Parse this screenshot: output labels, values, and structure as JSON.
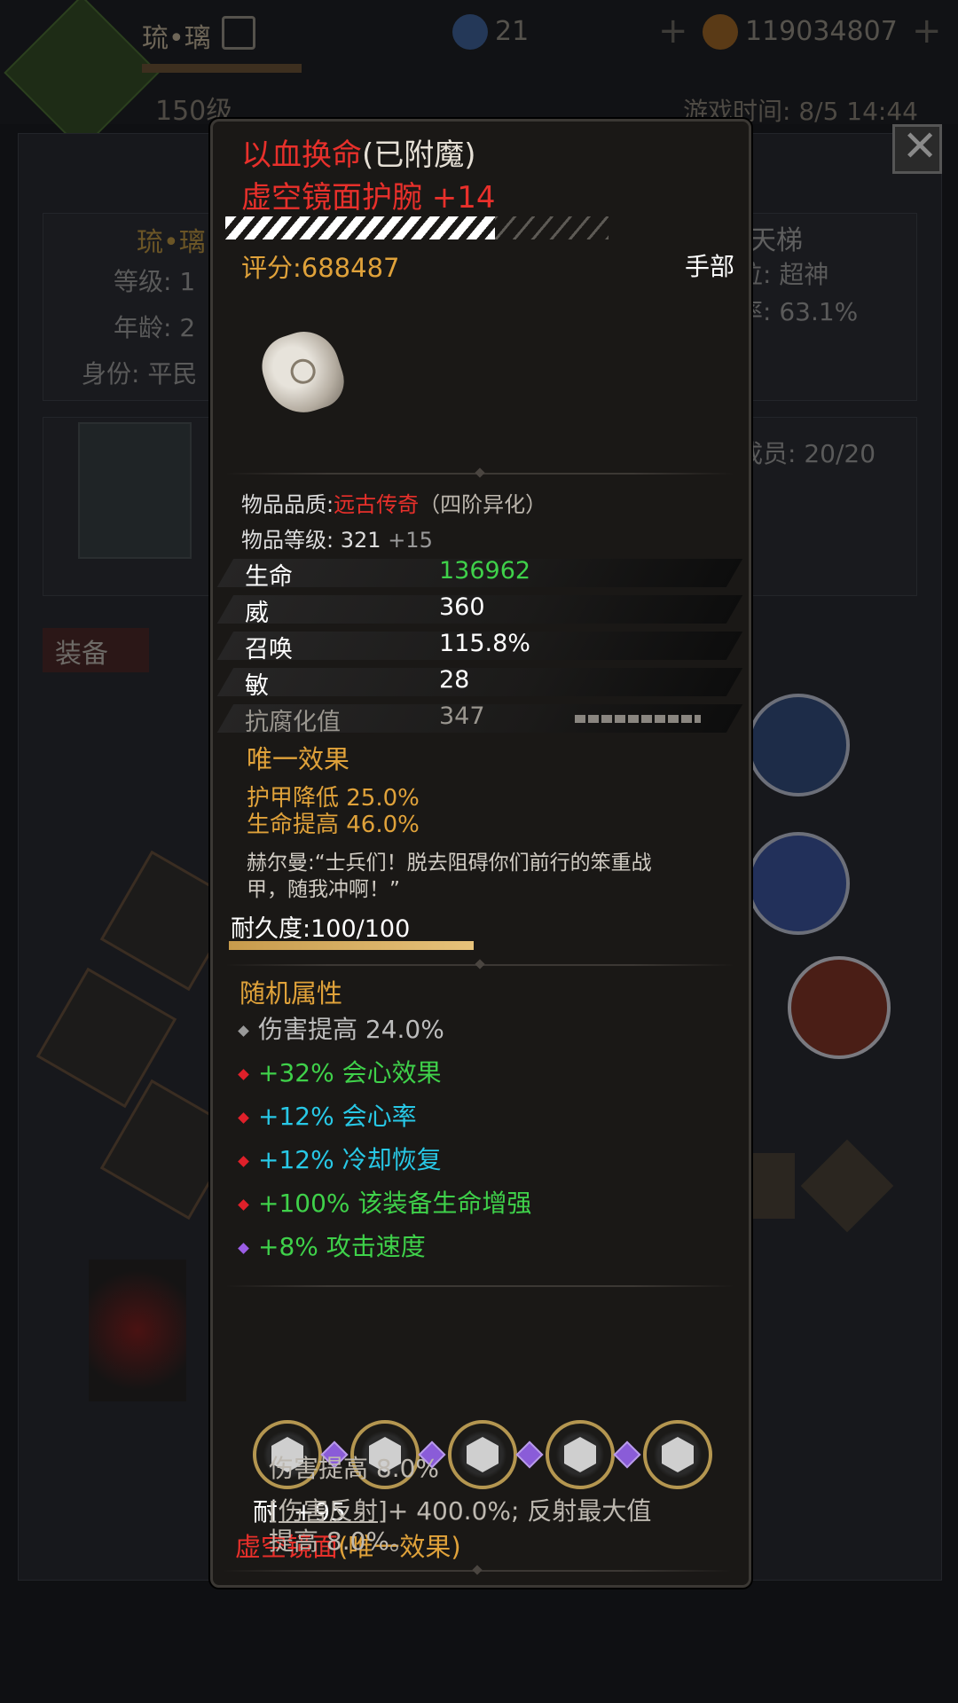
{
  "background": {
    "player_name": "琉•璃",
    "player_level": "150级",
    "currency1": "21",
    "currency2": "119034807",
    "game_time": "游戏时间: 8/5 14:44",
    "profile_name": "琉•璃",
    "level_label": "等级: 1",
    "age_label": "年龄: 2",
    "identity_label": "身份: 平民",
    "ladder_label": "天梯",
    "rank_label": "位: 超神",
    "rate_label": "率: 63.1%",
    "members_label": "成员: 20/20",
    "equipment_tab": "装备"
  },
  "tooltip": {
    "enchant_name": "以血换命",
    "enchant_status": "(已附魔)",
    "item_name": "虚空镜面护腕 +14",
    "score": "评分:688487",
    "slot": "手部",
    "quality_label": "物品品质:",
    "quality_value": "远古传奇",
    "quality_tier": "（四阶异化）",
    "item_level_label": "物品等级:",
    "item_level_value": "321",
    "item_level_bonus": "+15",
    "stats": [
      {
        "label": "生命",
        "value": "136962"
      },
      {
        "label": "威",
        "value": "360"
      },
      {
        "label": "召唤",
        "value": "115.8%"
      },
      {
        "label": "敏",
        "value": "28"
      },
      {
        "label": "抗腐化值",
        "value": "347"
      }
    ],
    "unique_title": "唯一效果",
    "unique_effects": [
      "护甲降低 25.0%",
      "生命提高 46.0%"
    ],
    "quote_line1": "赫尔曼:“士兵们！脱去阻碍你们前行的笨重战",
    "quote_line2": "甲，随我冲啊！”",
    "durability": "耐久度:100/100",
    "durability_fraction": 1.0,
    "random_title": "随机属性",
    "random_attrs": [
      {
        "text": "伤害提高 24.0%",
        "color": "#bdbdbd",
        "gem": "#9a9a9a"
      },
      {
        "text": "+32% 会心效果",
        "color": "#3fd14a",
        "gem": "#e0202a"
      },
      {
        "text": "+12% 会心率",
        "color": "#28c8e6",
        "gem": "#e0202a"
      },
      {
        "text": "+12% 冷却恢复",
        "color": "#28c8e6",
        "gem": "#e0202a"
      },
      {
        "text": "+100% 该装备生命增强",
        "color": "#3fd14a",
        "gem": "#e0202a"
      },
      {
        "text": "+8% 攻击速度",
        "color": "#3fd14a",
        "gem": "#9b5de5"
      }
    ],
    "socket_bonus": "耐  +95",
    "set_name": "虚空镜面",
    "set_suffix": "(唯一效果)",
    "set_effect1": "伤害提高 8.0%",
    "set_effect2_link": "[伤害反射]",
    "set_effect2_rest": "+ 400.0%; 反射最大值",
    "set_effect2_line2": "提高 8.0%。"
  },
  "colors": {
    "red": "#e8302b",
    "gold": "#e0a23a",
    "green": "#3fd14a",
    "cyan": "#28c8e6"
  }
}
